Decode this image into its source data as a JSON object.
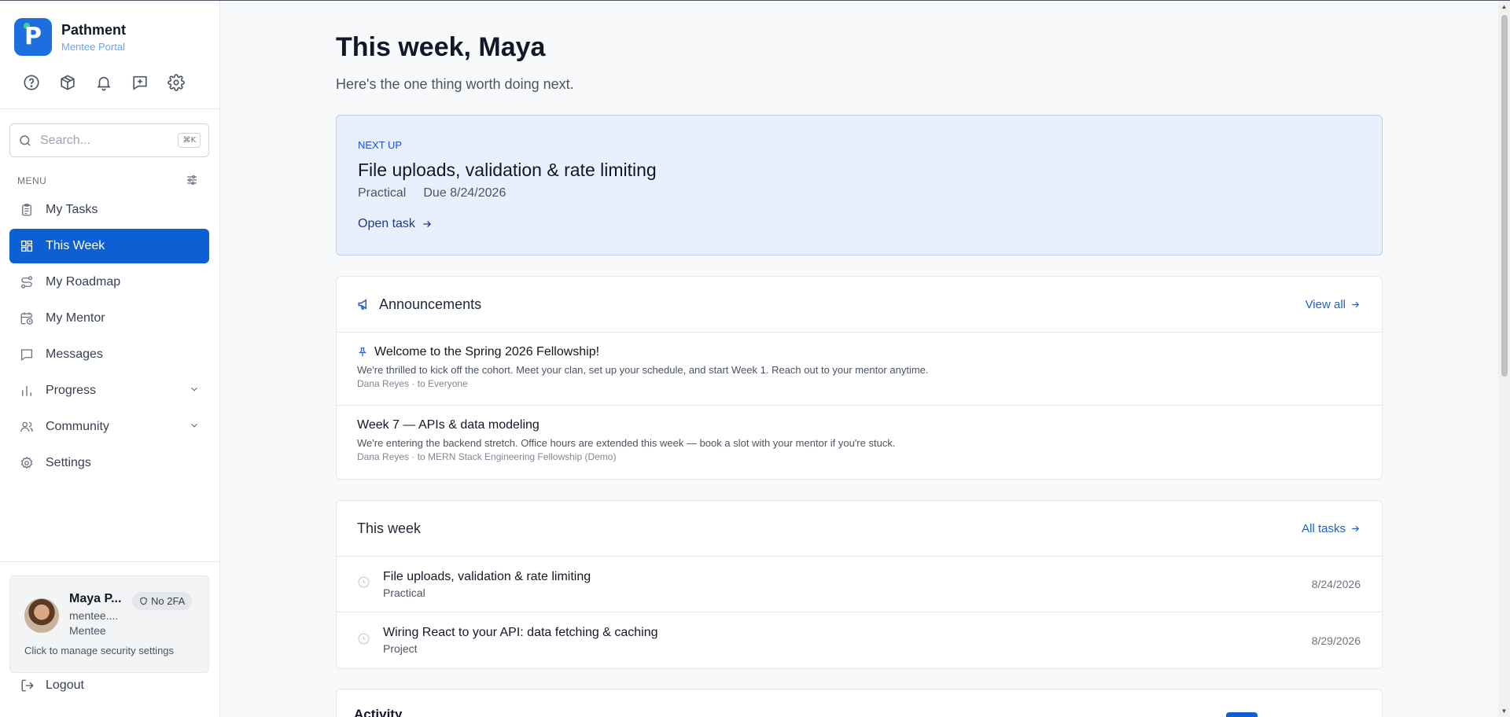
{
  "brand": {
    "name": "Pathment",
    "subtitle": "Mentee Portal",
    "logo_letter": "P"
  },
  "header_icons": [
    "help-circle-icon",
    "package-icon",
    "bell-icon",
    "message-plus-icon",
    "gear-icon"
  ],
  "search": {
    "placeholder": "Search...",
    "shortcut": "⌘K"
  },
  "menu": {
    "label": "MENU",
    "items": [
      {
        "label": "My Tasks",
        "icon": "clipboard-icon"
      },
      {
        "label": "This Week",
        "icon": "grid-icon",
        "active": true
      },
      {
        "label": "My Roadmap",
        "icon": "route-icon"
      },
      {
        "label": "My Mentor",
        "icon": "calendar-clock-icon"
      },
      {
        "label": "Messages",
        "icon": "message-square-icon"
      },
      {
        "label": "Progress",
        "icon": "bar-chart-icon",
        "expandable": true
      },
      {
        "label": "Community",
        "icon": "users-icon",
        "expandable": true
      },
      {
        "label": "Settings",
        "icon": "gear-icon"
      }
    ]
  },
  "user": {
    "name": "Maya P...",
    "email": "mentee....",
    "role": "Mentee",
    "badge": "No 2FA",
    "hint": "Click to manage security settings"
  },
  "logout_label": "Logout",
  "page": {
    "title": "This week, Maya",
    "subtitle": "Here's the one thing worth doing next."
  },
  "next_up": {
    "label": "NEXT UP",
    "title": "File uploads, validation & rate limiting",
    "type": "Practical",
    "due": "Due 8/24/2026",
    "link": "Open task"
  },
  "announcements": {
    "title": "Announcements",
    "view_all": "View all",
    "items": [
      {
        "title": "Welcome to the Spring 2026 Fellowship!",
        "pinned": true,
        "body": "We're thrilled to kick off the cohort. Meet your clan, set up your schedule, and start Week 1. Reach out to your mentor anytime.",
        "meta": "Dana Reyes · to Everyone"
      },
      {
        "title": "Week 7 — APIs & data modeling",
        "pinned": false,
        "body": "We're entering the backend stretch. Office hours are extended this week — book a slot with your mentor if you're stuck.",
        "meta": "Dana Reyes · to MERN Stack Engineering Fellowship (Demo)"
      }
    ]
  },
  "this_week": {
    "title": "This week",
    "all_tasks": "All tasks",
    "tasks": [
      {
        "title": "File uploads, validation & rate limiting",
        "kind": "Practical",
        "date": "8/24/2026"
      },
      {
        "title": "Wiring React to your API: data fetching & caching",
        "kind": "Project",
        "date": "8/29/2026"
      }
    ]
  },
  "activity": {
    "title": "Activity"
  },
  "colors": {
    "accent": "#0d5fd4",
    "next_bg": "#e8f0fd",
    "link": "#1d5fd6"
  }
}
